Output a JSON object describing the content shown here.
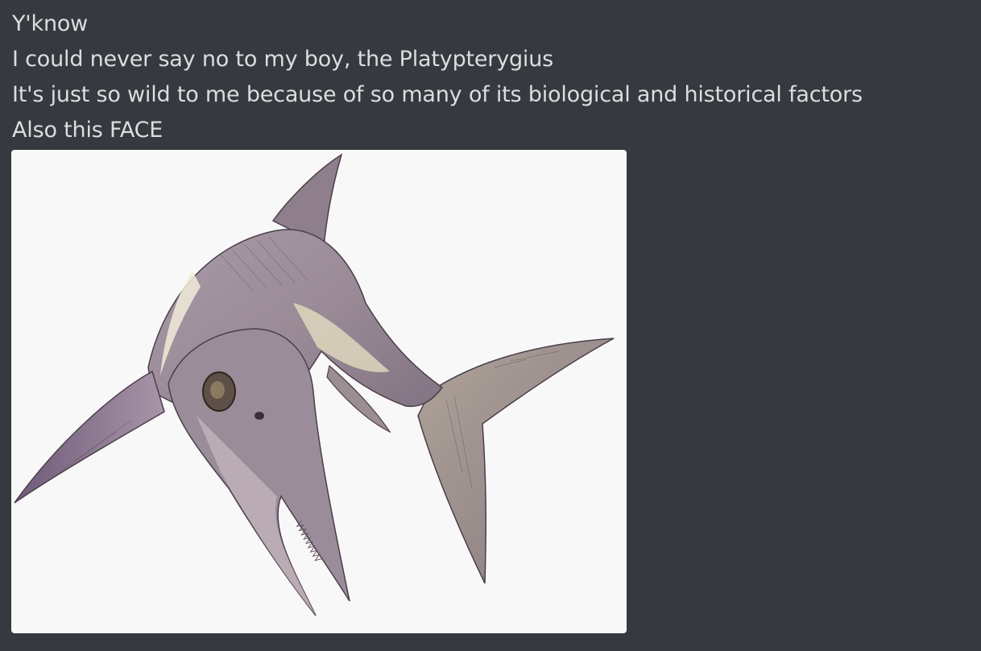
{
  "messages": [
    {
      "text": "Y'know"
    },
    {
      "text": "I could never say no to my boy, the Platypterygius"
    },
    {
      "text": "It's just so wild to me because of so many of its biological and historical factors"
    },
    {
      "text": "Also this FACE"
    }
  ],
  "attachment": {
    "type": "image",
    "subject": "ichthyosaur-drawing"
  },
  "colors": {
    "background": "#36393f",
    "text": "#dcddde",
    "image_bg": "#f8f8f8"
  }
}
